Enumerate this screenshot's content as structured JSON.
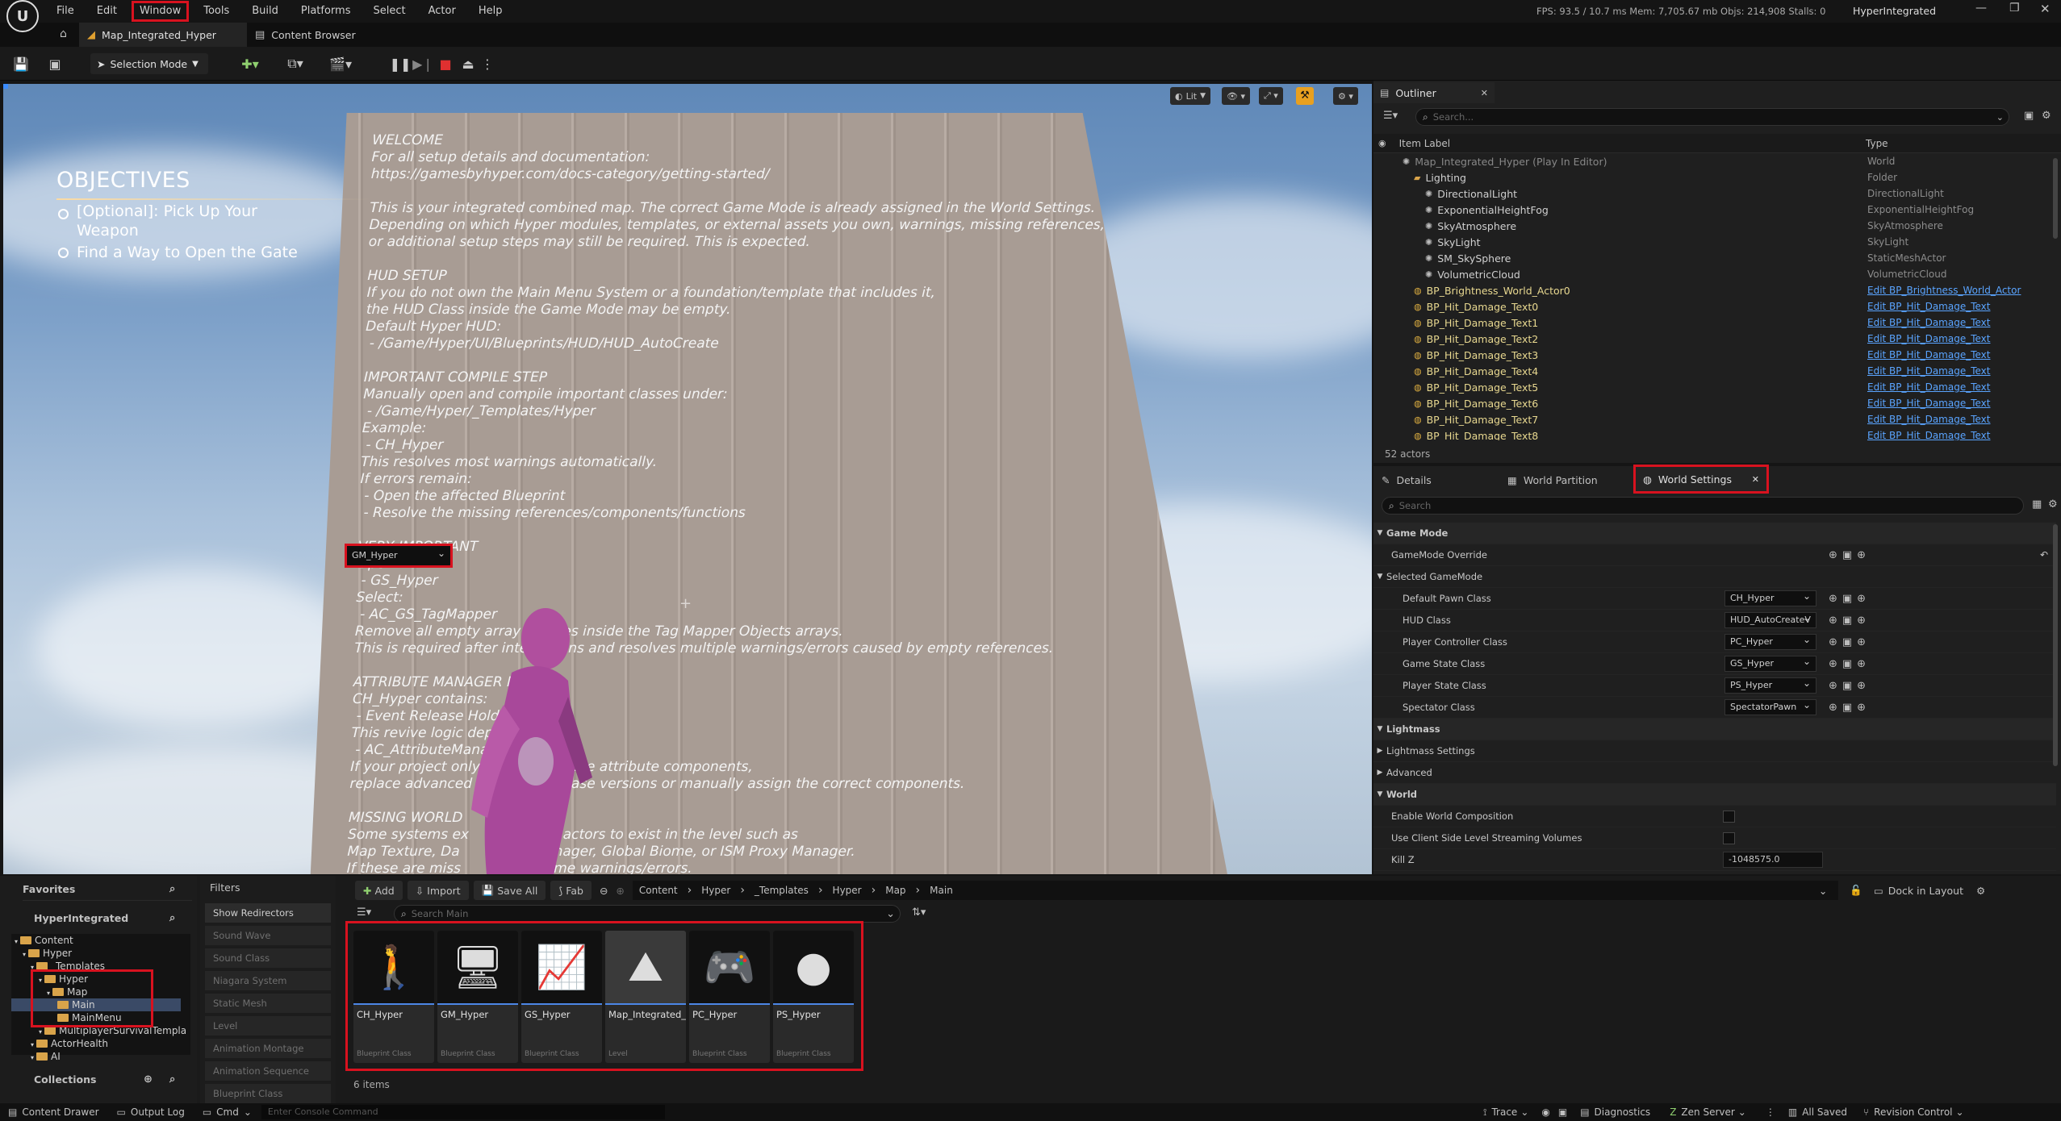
{
  "menu": {
    "items": [
      "File",
      "Edit",
      "Window",
      "Tools",
      "Build",
      "Platforms",
      "Select",
      "Actor",
      "Help"
    ],
    "stats": "FPS: 93.5  /  10.7 ms  Mem: 7,705.67 mb  Objs: 214,908  Stalls: 0",
    "project": "HyperIntegrated"
  },
  "tabs": {
    "map": "Map_Integrated_Hyper",
    "content_browser": "Content Browser"
  },
  "toolbar": {
    "mode": "Selection Mode"
  },
  "viewport": {
    "lit": "Lit"
  },
  "objectives": {
    "title": "OBJECTIVES",
    "items": [
      "[Optional]: Pick Up Your Weapon",
      "Find a Way to Open the Gate"
    ]
  },
  "wall_text": "WELCOME\nFor all setup details and documentation:\nhttps://gamesbyhyper.com/docs-category/getting-started/\n\nThis is your integrated combined map. The correct Game Mode is already assigned in the World Settings.\nDepending on which Hyper modules, templates, or external assets you own, warnings, missing references,\nor additional setup steps may still be required. This is expected.\n\nHUD SETUP\nIf you do not own the Main Menu System or a foundation/template that includes it,\nthe HUD Class inside the Game Mode may be empty.\nDefault Hyper HUD:\n - /Game/Hyper/UI/Blueprints/HUD/HUD_AutoCreate\n\nIMPORTANT COMPILE STEP\nManually open and compile important classes under:\n - /Game/Hyper/_Templates/Hyper\nExample:\n - CH_Hyper\nThis resolves most warnings automatically.\nIf errors remain:\n - Open the affected Blueprint\n - Resolve the missing references/components/functions\n\nVERY IMPORTANT\nOpen:\n - GS_Hyper\nSelect:\n - AC_GS_TagMapper\nRemove all empty array indexes inside the Tag Mapper Objects arrays.\nThis is required after integrations and resolves multiple warnings/errors caused by empty references.\n\nATTRIBUTE MANAGER NOTE\nCH_Hyper contains:\n - Event Release Hold\nThis revive logic depends o\n - AC_AttributeManager\nIf your project only cont           base attribute components,\nreplace advanced co           ith base versions or manually assign the correct components.\n\nMISSING WORLD\nSome systems ex           global actors to exist in the level such as\nMap Texture, Da           me Manager, Global Biome, or ISM Proxy Manager.\nIf these are miss           e runtime warnings/errors.\nDrag the require           the level or remove the dependent systems/features.\n\nIMPORTANT\nThis integration                 integration work but cannot create a perfect setup",
  "outliner": {
    "title": "Outliner",
    "search": "Search...",
    "col_label": "Item Label",
    "col_type": "Type",
    "rows": [
      {
        "label": "Map_Integrated_Hyper (Play In Editor)",
        "type": "World",
        "indent": 0,
        "dim": true
      },
      {
        "label": "Lighting",
        "type": "Folder",
        "indent": 1
      },
      {
        "label": "DirectionalLight",
        "type": "DirectionalLight",
        "indent": 2
      },
      {
        "label": "ExponentialHeightFog",
        "type": "ExponentialHeightFog",
        "indent": 2
      },
      {
        "label": "SkyAtmosphere",
        "type": "SkyAtmosphere",
        "indent": 2
      },
      {
        "label": "SkyLight",
        "type": "SkyLight",
        "indent": 2
      },
      {
        "label": "SM_SkySphere",
        "type": "StaticMeshActor",
        "indent": 2
      },
      {
        "label": "VolumetricCloud",
        "type": "VolumetricCloud",
        "indent": 2
      },
      {
        "label": "BP_Brightness_World_Actor0",
        "type": "Edit BP_Brightness_World_Actor",
        "indent": 1,
        "bp": true
      },
      {
        "label": "BP_Hit_Damage_Text0",
        "type": "Edit BP_Hit_Damage_Text",
        "indent": 1,
        "bp": true
      },
      {
        "label": "BP_Hit_Damage_Text1",
        "type": "Edit BP_Hit_Damage_Text",
        "indent": 1,
        "bp": true
      },
      {
        "label": "BP_Hit_Damage_Text2",
        "type": "Edit BP_Hit_Damage_Text",
        "indent": 1,
        "bp": true
      },
      {
        "label": "BP_Hit_Damage_Text3",
        "type": "Edit BP_Hit_Damage_Text",
        "indent": 1,
        "bp": true
      },
      {
        "label": "BP_Hit_Damage_Text4",
        "type": "Edit BP_Hit_Damage_Text",
        "indent": 1,
        "bp": true
      },
      {
        "label": "BP_Hit_Damage_Text5",
        "type": "Edit BP_Hit_Damage_Text",
        "indent": 1,
        "bp": true
      },
      {
        "label": "BP_Hit_Damage_Text6",
        "type": "Edit BP_Hit_Damage_Text",
        "indent": 1,
        "bp": true
      },
      {
        "label": "BP_Hit_Damage_Text7",
        "type": "Edit BP_Hit_Damage_Text",
        "indent": 1,
        "bp": true
      },
      {
        "label": "BP_Hit_Damage_Text8",
        "type": "Edit BP_Hit_Damage_Text",
        "indent": 1,
        "bp": true
      }
    ],
    "count": "52 actors"
  },
  "details": {
    "tab_details": "Details",
    "tab_partition": "World Partition",
    "tab_world": "World Settings",
    "search": "Search",
    "game_mode": "Game Mode",
    "gm_override_label": "GameMode Override",
    "gm_override": "GM_Hyper",
    "selected_gm": "Selected GameMode",
    "props": [
      {
        "label": "Default Pawn Class",
        "value": "CH_Hyper"
      },
      {
        "label": "HUD Class",
        "value": "HUD_AutoCreateV"
      },
      {
        "label": "Player Controller Class",
        "value": "PC_Hyper"
      },
      {
        "label": "Game State Class",
        "value": "GS_Hyper"
      },
      {
        "label": "Player State Class",
        "value": "PS_Hyper"
      },
      {
        "label": "Spectator Class",
        "value": "SpectatorPawn"
      }
    ],
    "lightmass": "Lightmass",
    "lightmass_settings": "Lightmass Settings",
    "advanced": "Advanced",
    "world": "World",
    "enable_wc": "Enable World Composition",
    "use_cs": "Use Client Side Level Streaming Volumes",
    "killz_label": "Kill Z",
    "killz": "-1048575.0"
  },
  "content": {
    "favorites": "Favorites",
    "project": "HyperIntegrated",
    "filters": "Filters",
    "collections": "Collections",
    "tree": [
      {
        "label": "Content",
        "indent": 0
      },
      {
        "label": "Hyper",
        "indent": 1
      },
      {
        "label": "_Templates",
        "indent": 2
      },
      {
        "label": "Hyper",
        "indent": 3
      },
      {
        "label": "Map",
        "indent": 4
      },
      {
        "label": "Main",
        "indent": 5,
        "sel": true
      },
      {
        "label": "MainMenu",
        "indent": 5
      },
      {
        "label": "MultiplayerSurvivalTempla",
        "indent": 3
      },
      {
        "label": "ActorHealth",
        "indent": 2
      },
      {
        "label": "AI",
        "indent": 2
      }
    ],
    "filter_items": [
      "Show Redirectors",
      "Sound Wave",
      "Sound Class",
      "Niagara System",
      "Static Mesh",
      "Level",
      "Animation Montage",
      "Animation Sequence",
      "Blueprint Class"
    ],
    "add": "Add",
    "import": "Import",
    "save_all": "Save All",
    "fab": "Fab",
    "path": [
      "Content",
      "Hyper",
      "_Templates",
      "Hyper",
      "Map",
      "Main"
    ],
    "search": "Search Main",
    "dock": "Dock in Layout",
    "assets": [
      {
        "name": "CH_Hyper",
        "type": "Blueprint Class"
      },
      {
        "name": "GM_Hyper",
        "type": "Blueprint Class"
      },
      {
        "name": "GS_Hyper",
        "type": "Blueprint Class"
      },
      {
        "name": "Map_Integrated_Hyper",
        "type": "Level"
      },
      {
        "name": "PC_Hyper",
        "type": "Blueprint Class"
      },
      {
        "name": "PS_Hyper",
        "type": "Blueprint Class"
      }
    ],
    "count": "6 items"
  },
  "statusbar": {
    "drawer": "Content Drawer",
    "output": "Output Log",
    "cmd": "Cmd",
    "console": "Enter Console Command",
    "trace": "Trace",
    "diagnostics": "Diagnostics",
    "zen": "Zen Server",
    "saved": "All Saved",
    "revision": "Revision Control"
  }
}
